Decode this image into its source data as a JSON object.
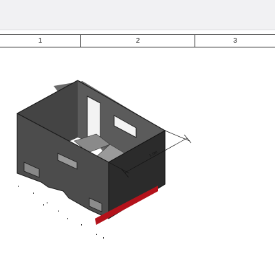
{
  "columns": [
    {
      "label": "1"
    },
    {
      "label": "2"
    },
    {
      "label": "3"
    }
  ],
  "dimension": {
    "text": "1.180"
  },
  "colors": {
    "wall_front": "#4f4f4f",
    "wall_side": "#2f2f2f",
    "wall_top": "#7a7a7a",
    "interior": "#565656",
    "accent_red": "#b3121b"
  }
}
